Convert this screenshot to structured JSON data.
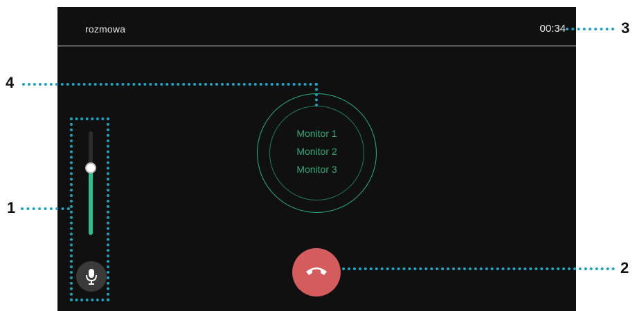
{
  "screen": {
    "title": "rozmowa",
    "timer": "00:34"
  },
  "monitors": {
    "items": [
      "Monitor 1",
      "Monitor 2",
      "Monitor 3"
    ]
  },
  "volume": {
    "level_fraction": 0.65
  },
  "controls": {
    "mic_icon": "microphone-icon",
    "hangup_icon": "phone-hangup-icon"
  },
  "annotations": {
    "labels": [
      "1",
      "2",
      "3",
      "4"
    ]
  },
  "colors": {
    "screen_bg": "#101010",
    "accent_green": "#2bbf8a",
    "hangup_red": "#d45c5c",
    "annotation_blue": "#1fa4bf"
  }
}
